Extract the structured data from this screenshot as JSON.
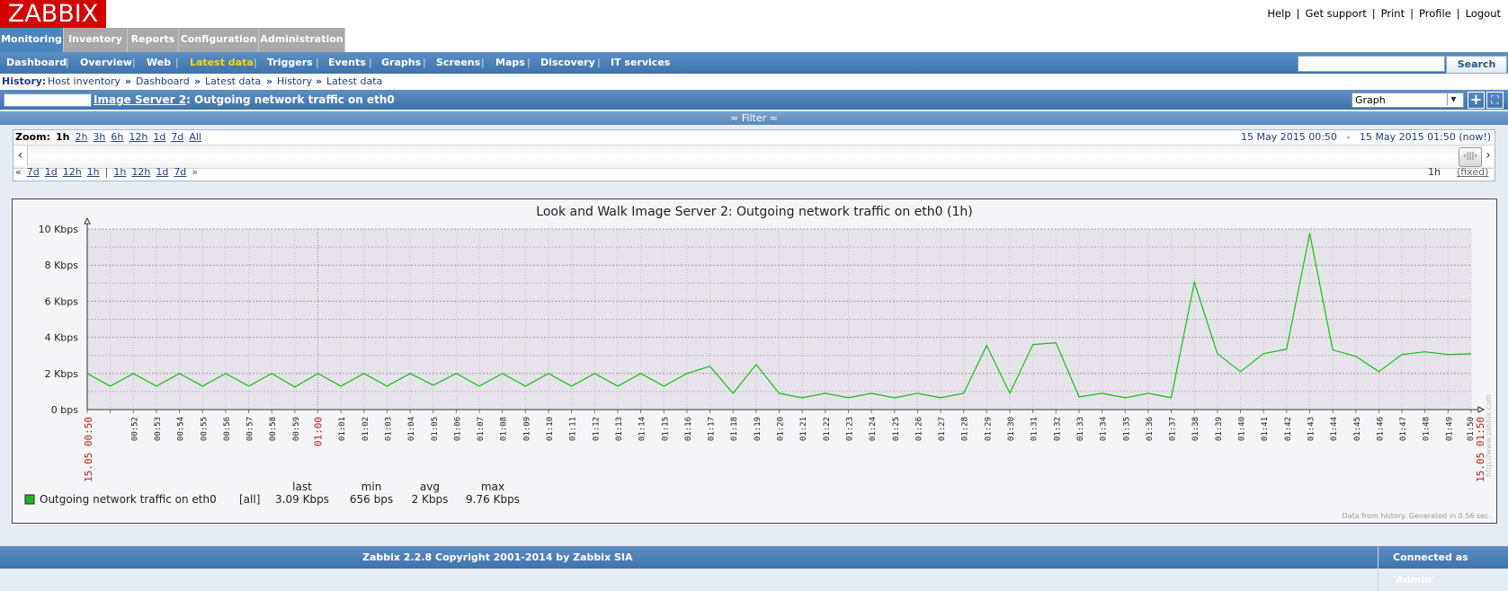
{
  "header": {
    "logo": "ZABBIX",
    "links": [
      "Help",
      "Get support",
      "Print",
      "Profile",
      "Logout"
    ]
  },
  "tabs": [
    {
      "label": "Monitoring",
      "active": true
    },
    {
      "label": "Inventory",
      "active": false
    },
    {
      "label": "Reports",
      "active": false
    },
    {
      "label": "Configuration",
      "active": false
    },
    {
      "label": "Administration",
      "active": false
    }
  ],
  "subnav": {
    "items": [
      "Dashboard",
      "Overview",
      "Web",
      "Latest data",
      "Triggers",
      "Events",
      "Graphs",
      "Screens",
      "Maps",
      "Discovery",
      "IT services"
    ],
    "active": "Latest data",
    "search_button": "Search",
    "search_value": ""
  },
  "history": {
    "label": "History:",
    "crumbs": [
      "Host inventory",
      "Dashboard",
      "Latest data",
      "History",
      "Latest data"
    ]
  },
  "titlebar": {
    "host_input": "",
    "host_link": "Image Server 2",
    "title_rest": ": Outgoing network traffic on eth0",
    "view_select": "Graph"
  },
  "filter": {
    "label": "≈ Filter ≈"
  },
  "scroll": {
    "zoom_label": "Zoom:",
    "zoom_current": "1h",
    "zoom_options": [
      "2h",
      "3h",
      "6h",
      "12h",
      "1d",
      "7d",
      "All"
    ],
    "period_from": "15 May 2015 00:50",
    "period_sep": "-",
    "period_to": "15 May 2015 01:50",
    "period_note": "(now!)",
    "back_symbol": "«",
    "back_options": [
      "7d",
      "1d",
      "12h",
      "1h"
    ],
    "divider": "|",
    "fwd_options": [
      "1h",
      "12h",
      "1d",
      "7d"
    ],
    "fwd_symbol": "»",
    "period_length": "1h",
    "fixed": "(fixed)",
    "left_arrow": "‹",
    "right_arrow": "›",
    "thumb_label": "‹|||›"
  },
  "chart_data": {
    "type": "line",
    "title": "Look and Walk Image Server 2: Outgoing network traffic on eth0 (1h)",
    "xlabel": "",
    "ylabel": "",
    "ylim": [
      0,
      10
    ],
    "y_unit": "Kbps",
    "y_ticks": [
      "0 bps",
      "2 Kbps",
      "4 Kbps",
      "6 Kbps",
      "8 Kbps",
      "10 Kbps"
    ],
    "x_start_label": "15.05 00:50",
    "x_end_label": "15.05 01:50",
    "x_labels": [
      "00:52",
      "00:53",
      "00:54",
      "00:55",
      "00:56",
      "00:57",
      "00:58",
      "00:59",
      "01:00",
      "01:01",
      "01:02",
      "01:03",
      "01:04",
      "01:05",
      "01:06",
      "01:07",
      "01:08",
      "01:09",
      "01:10",
      "01:11",
      "01:12",
      "01:13",
      "01:14",
      "01:15",
      "01:16",
      "01:17",
      "01:18",
      "01:19",
      "01:20",
      "01:21",
      "01:22",
      "01:23",
      "01:24",
      "01:25",
      "01:26",
      "01:27",
      "01:28",
      "01:29",
      "01:30",
      "01:31",
      "01:32",
      "01:33",
      "01:34",
      "01:35",
      "01:36",
      "01:37",
      "01:38",
      "01:39",
      "01:40",
      "01:41",
      "01:42",
      "01:43",
      "01:44",
      "01:45",
      "01:46",
      "01:47",
      "01:48",
      "01:49",
      "01:50"
    ],
    "highlight_labels": [
      "01:00"
    ],
    "series": [
      {
        "name": "Outgoing network traffic on eth0",
        "color": "#1bb81b",
        "minutes": [
          0.0,
          1.0,
          2.0,
          3.0,
          4.0,
          5.0,
          6.0,
          7.0,
          8.0,
          9.0,
          10.0,
          11.0,
          12.0,
          13.0,
          14.0,
          15.0,
          16.0,
          17.0,
          18.0,
          19.0,
          20.0,
          21.0,
          22.0,
          23.0,
          24.0,
          25.0,
          26.0,
          27.0,
          28.0,
          29.0,
          30.0,
          31.0,
          32.0,
          33.0,
          34.0,
          35.0,
          36.0,
          37.0,
          38.0,
          39.0,
          40.0,
          41.0,
          42.0,
          43.0,
          44.0,
          45.0,
          46.0,
          47.0,
          48.0,
          49.0,
          50.0,
          51.0,
          52.0,
          53.0,
          54.0,
          55.0,
          56.0,
          57.0,
          58.0,
          59.0,
          60.0
        ],
        "values": [
          2.0,
          1.3,
          2.0,
          1.3,
          2.0,
          1.3,
          2.0,
          1.3,
          2.0,
          1.25,
          2.0,
          1.3,
          2.0,
          1.3,
          2.0,
          1.35,
          2.0,
          1.3,
          2.0,
          1.3,
          2.0,
          1.3,
          2.0,
          1.3,
          2.0,
          1.3,
          2.0,
          2.4,
          0.9,
          2.5,
          0.9,
          0.65,
          0.9,
          0.65,
          0.9,
          0.65,
          0.9,
          0.65,
          0.9,
          3.55,
          0.9,
          3.6,
          3.7,
          0.7,
          0.9,
          0.65,
          0.9,
          0.65,
          7.05,
          3.1,
          2.1,
          3.1,
          3.35,
          9.76,
          3.3,
          2.95,
          2.1,
          3.05,
          3.2,
          3.05,
          3.09
        ]
      }
    ],
    "legend": {
      "headers": [
        "last",
        "min",
        "avg",
        "max"
      ],
      "name": "Outgoing network traffic on eth0",
      "func": "[all]",
      "last": "3.09 Kbps",
      "min": "656 bps",
      "avg": "2 Kbps",
      "max": "9.76 Kbps"
    },
    "side_note": "http://www.zabbix.com",
    "footnote": "Data from history. Generated in 0.56 sec.",
    "grid": true
  },
  "footer": {
    "copyright": "Zabbix 2.2.8 Copyright 2001-2014 by Zabbix SIA",
    "connected": "Connected as 'Admin'"
  }
}
